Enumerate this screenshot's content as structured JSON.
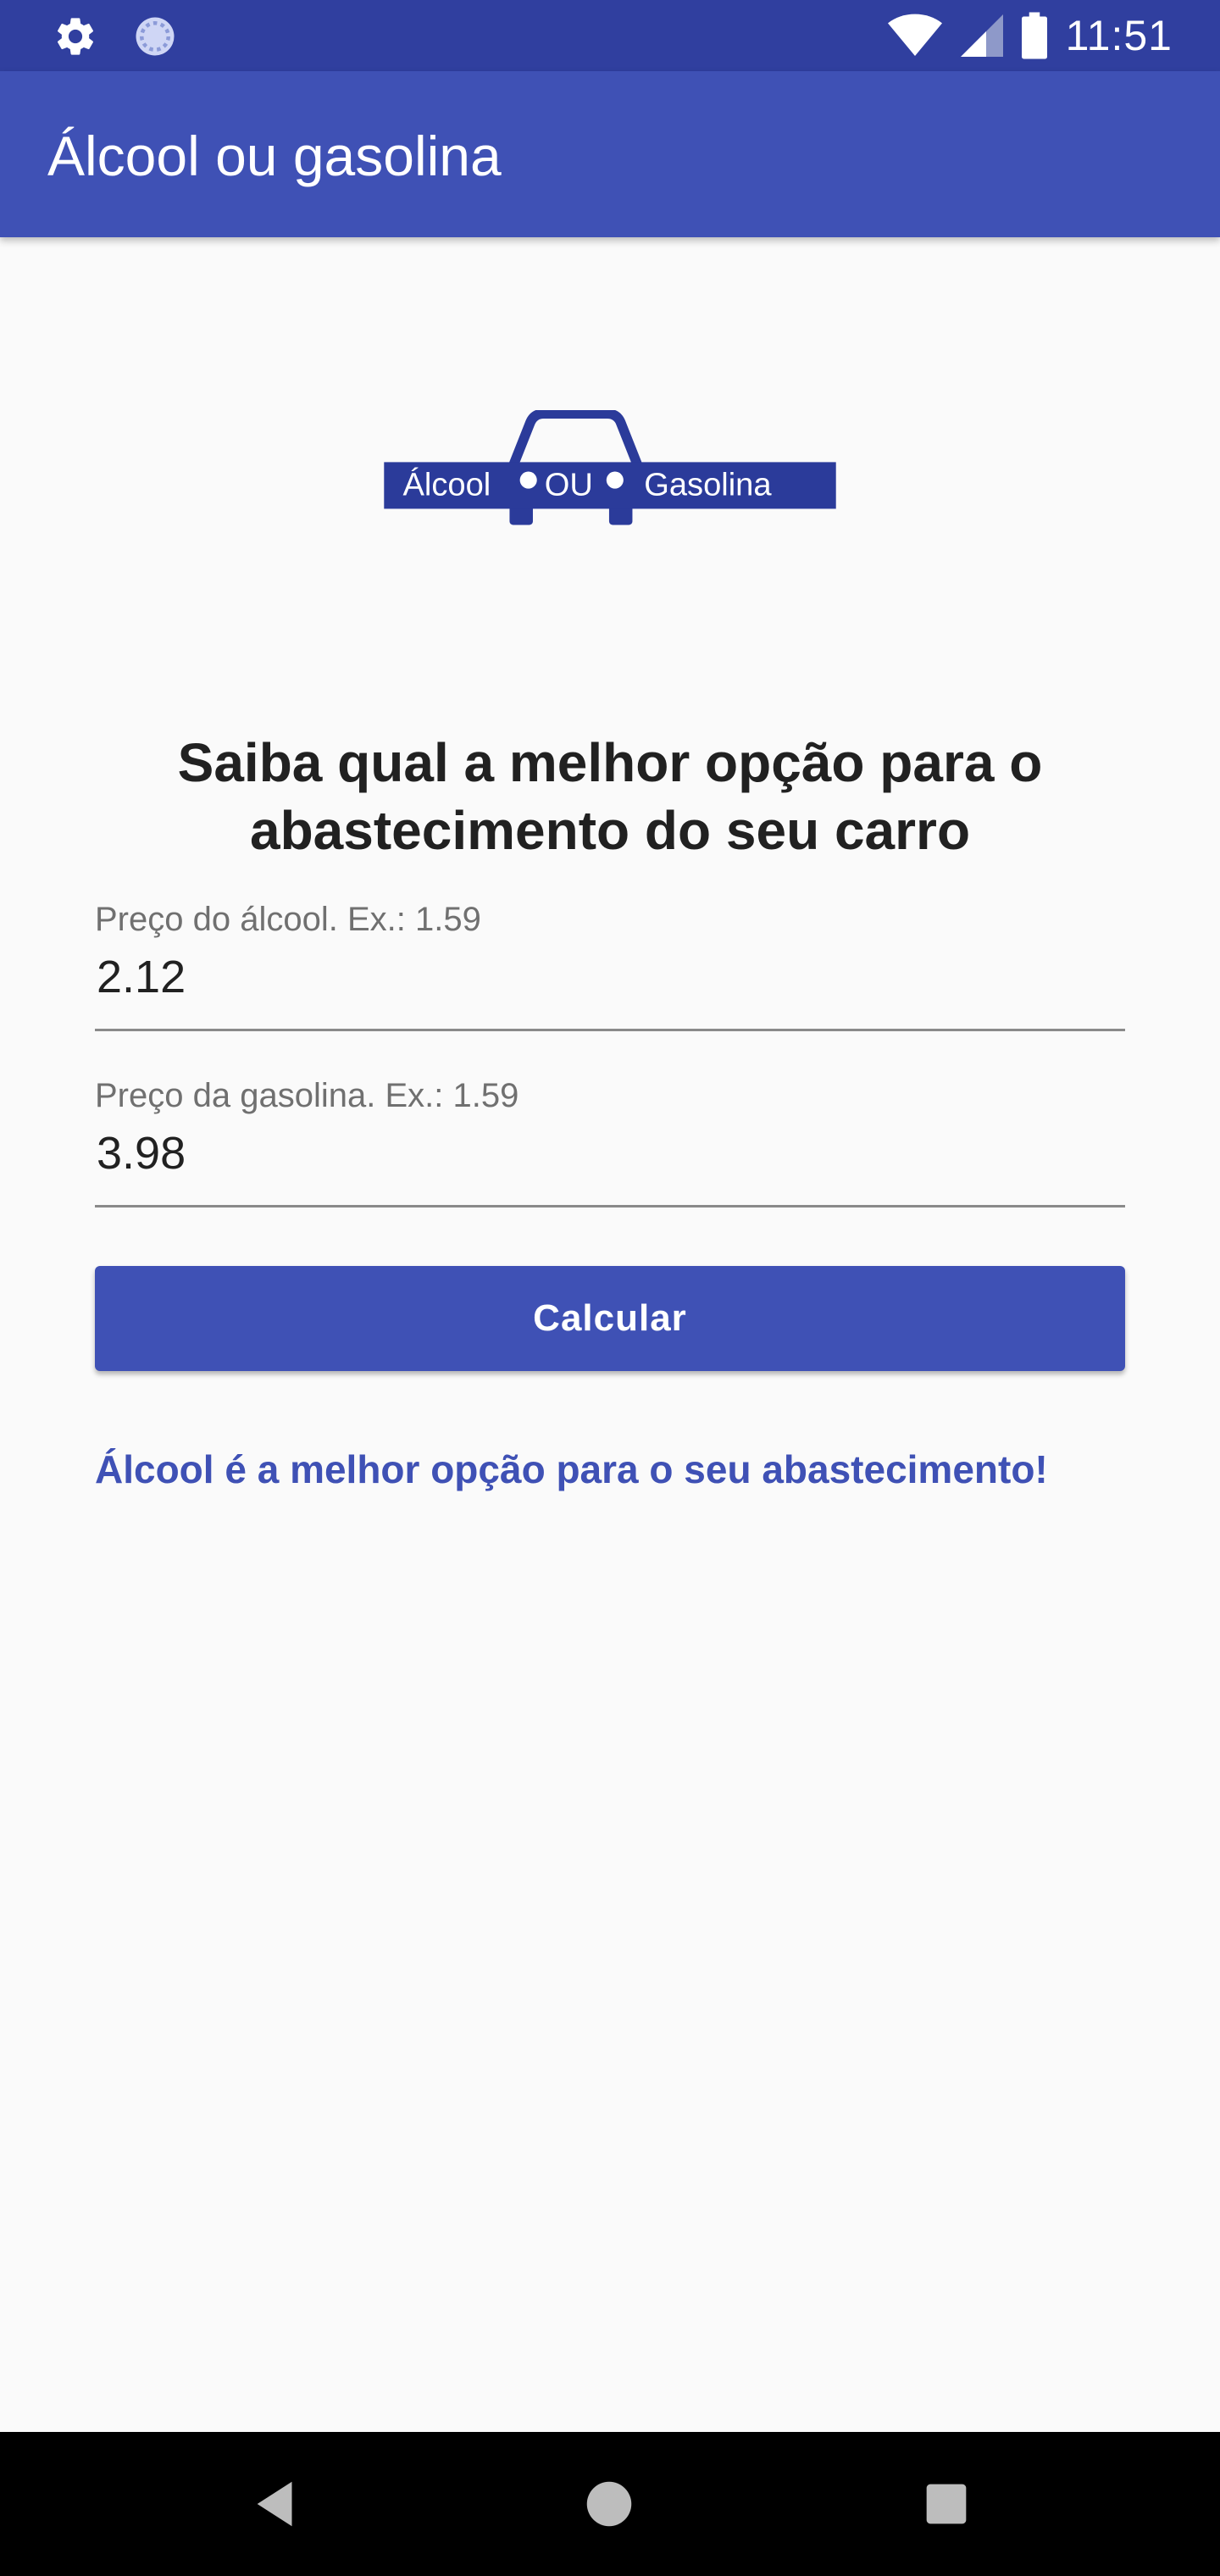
{
  "status_bar": {
    "time": "11:51",
    "icons": [
      "settings-icon",
      "sync-icon",
      "wifi-icon",
      "signal-icon",
      "battery-icon"
    ]
  },
  "app_bar": {
    "title": "Álcool ou gasolina",
    "color": "#3f51b5"
  },
  "logo": {
    "word_left": "Álcool",
    "word_middle": "OU",
    "word_right": "Gasolina",
    "color": "#2b3b9a"
  },
  "main": {
    "headline": "Saiba qual a melhor opção para o abastecimento do seu carro",
    "alcool_field": {
      "label": "Preço do álcool. Ex.: 1.59",
      "value": "2.12"
    },
    "gasolina_field": {
      "label": "Preço da gasolina. Ex.: 1.59",
      "value": "3.98"
    },
    "button_label": "Calcular",
    "result_text": "Álcool é a melhor opção para o seu abastecimento!"
  },
  "nav_bar": {
    "icons": [
      "back-icon",
      "home-icon",
      "recents-icon"
    ]
  }
}
